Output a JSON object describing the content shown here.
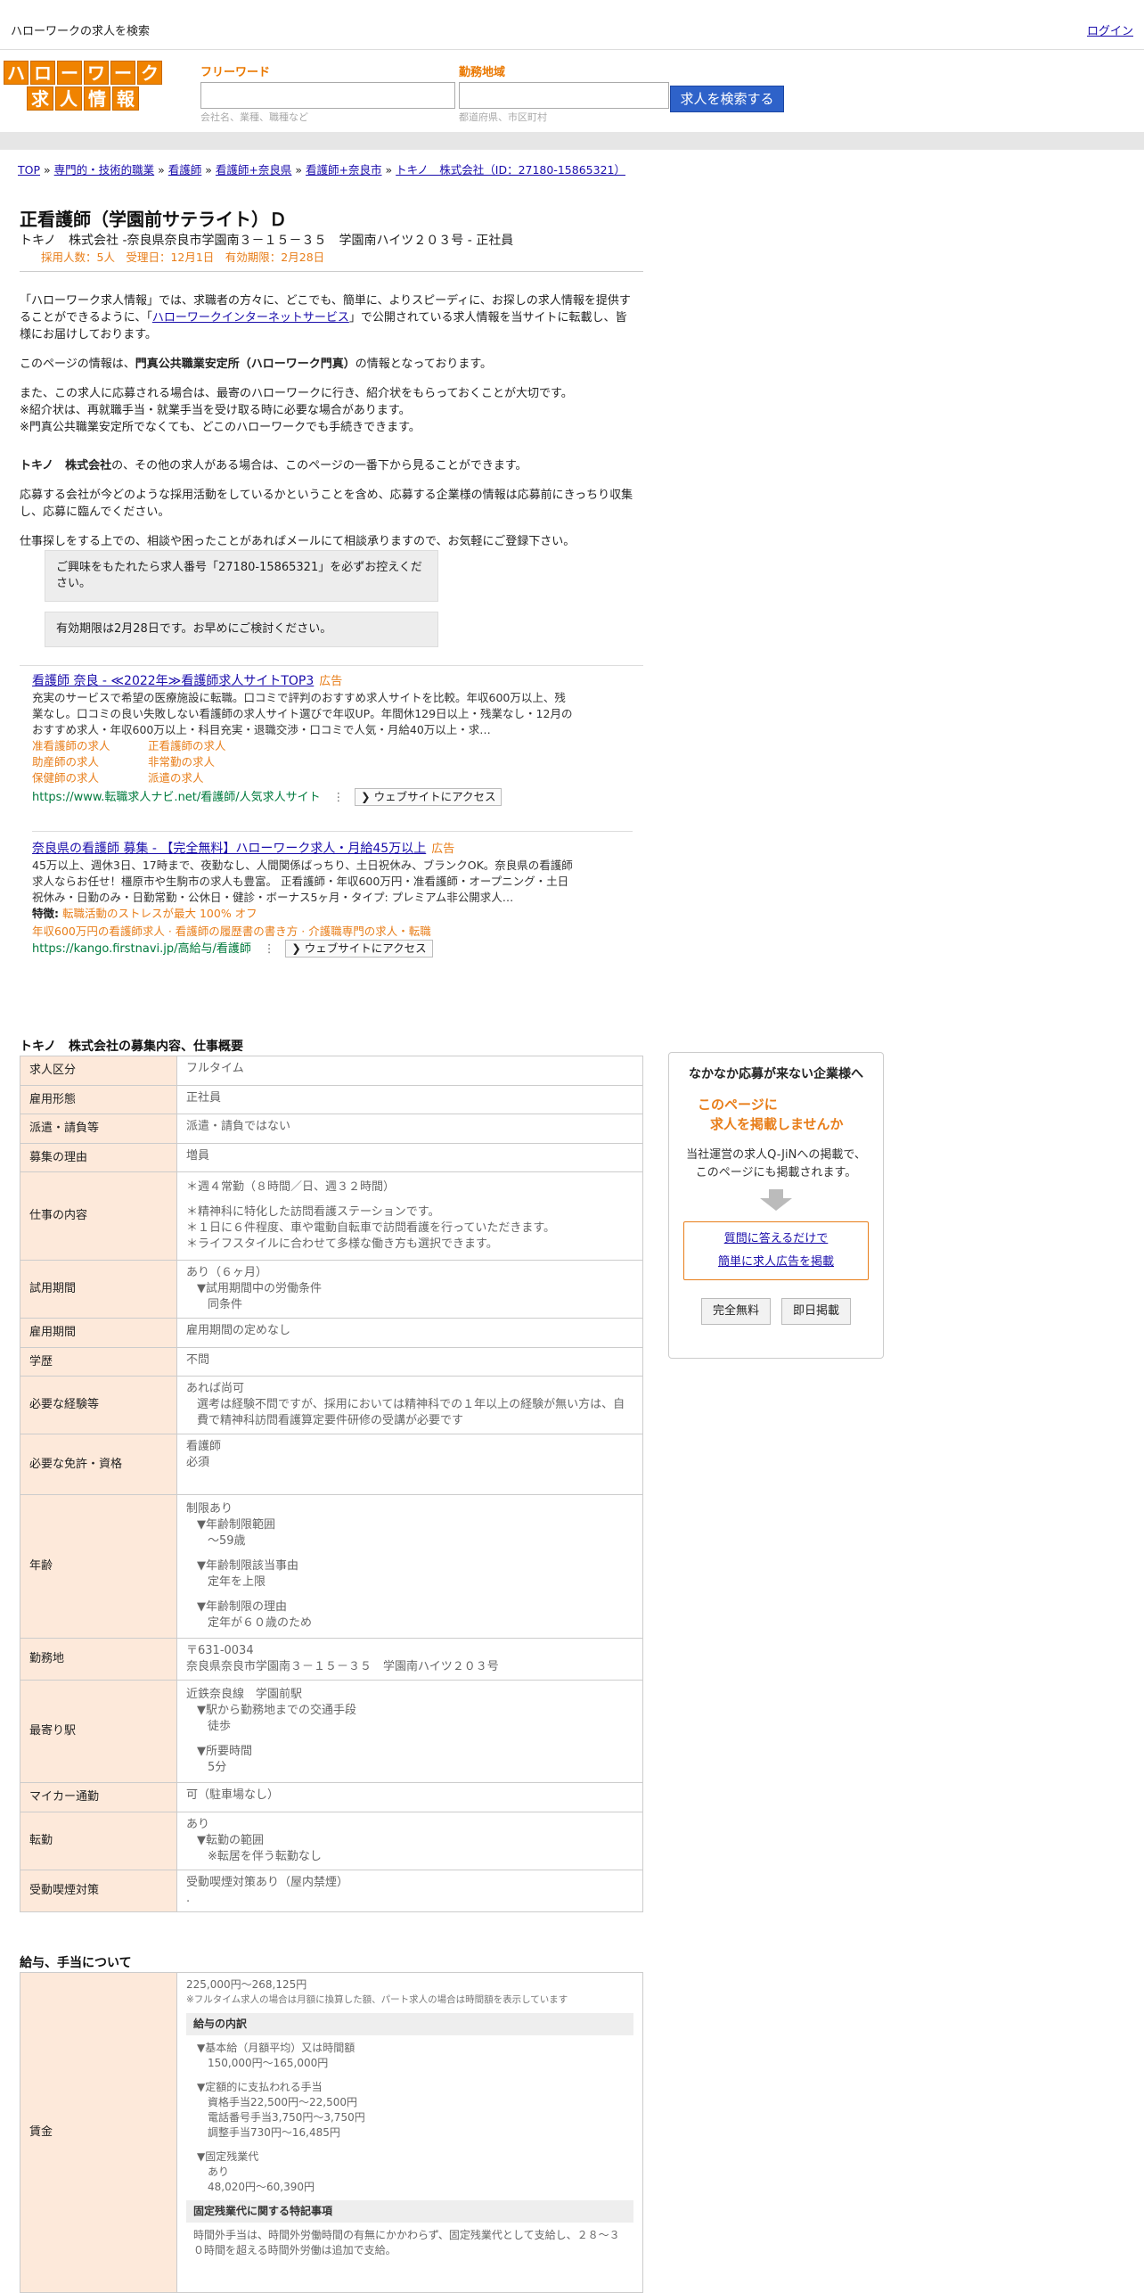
{
  "topbar": {
    "site_title": "ハローワークの求人を検索",
    "login": "ログイン"
  },
  "logo": {
    "row1": [
      "ハ",
      "ロ",
      "ー",
      "ワ",
      "ー",
      "ク"
    ],
    "row2": [
      "求",
      "人",
      "情",
      "報"
    ]
  },
  "search": {
    "keyword_label": "フリーワード",
    "keyword_placeholder": "会社名、業種、職種など",
    "location_label": "勤務地域",
    "location_placeholder": "都道府県、市区町村",
    "button": "求人を検索する"
  },
  "breadcrumb": [
    "TOP",
    "専門的・技術的職業",
    "看護師",
    "看護師+奈良県",
    "看護師+奈良市",
    "トキノ　株式会社（ID：27180-15865321）"
  ],
  "breadcrumb_sep": "»",
  "job": {
    "title": "正看護師（学園前サテライト）Ｄ",
    "company_line": "トキノ　株式会社 -奈良県奈良市学園南３－１５－３５　学園南ハイツ２０３号 - 正社員",
    "meta": "採用人数：5人　受理日：12月1日　有効期限：2月28日"
  },
  "intro": {
    "p1_a": "「ハローワーク求人情報」では、求職者の方々に、どこでも、簡単に、よりスピーディに、お探しの求人情報を提供することができるように、「",
    "p1_link": "ハローワークインターネットサービス",
    "p1_b": "」で公開されている求人情報を当サイトに転載し、皆様にお届けしております。",
    "p2_a": "このページの情報は、",
    "p2_bold": "門真公共職業安定所（ハローワーク門真）",
    "p2_b": "の情報となっております。",
    "p3_1": "また、この求人に応募される場合は、最寄のハローワークに行き、紹介状をもらっておくことが大切です。",
    "p3_2": "※紹介状は、再就職手当・就業手当を受け取る時に必要な場合があります。",
    "p3_3": "※門真公共職業安定所でなくても、どこのハローワークでも手続きできます。",
    "p4_bold": "トキノ　株式会社",
    "p4_rest": "の、その他の求人がある場合は、このページの一番下から見ることができます。",
    "p5": "応募する会社が今どのような採用活動をしているかということを含め、応募する企業様の情報は応募前にきっちり収集し、応募に臨んでください。",
    "p6": "仕事探しをする上での、相談や困ったことがあればメールにて相談承りますので、お気軽にご登録下さい。"
  },
  "notices": [
    "ご興味をもたれたら求人番号「27180-15865321」を必ずお控えください。",
    "有効期限は2月28日です。お早めにご検討ください。"
  ],
  "ads": [
    {
      "title": "看護師 奈良 - ≪2022年≫看護師求人サイトTOP3",
      "tag": "広告",
      "desc": "充実のサービスで希望の医療施設に転職。口コミで評判のおすすめ求人サイトを比較。年収600万以上、残業なし。口コミの良い失敗しない看護師の求人サイト選びで年収UP。年間休129日以上・残業なし・12月のおすすめ求人・年収600万以上・科目充実・退職交渉・口コミで人気・月給40万以上・求…",
      "links": [
        "准看護師の求人",
        "正看護師の求人",
        "助産師の求人",
        "非常勤の求人",
        "保健師の求人",
        "派遣の求人"
      ],
      "url": "https://www.転職求人ナビ.net/看護師/人気求人サイト",
      "visit": "❯ ウェブサイトにアクセス"
    },
    {
      "title": "奈良県の看護師 募集 - 【完全無料】ハローワーク求人・月給45万以上",
      "tag": "広告",
      "desc": "45万以上、週休3日、17時まで、夜勤なし、人間関係ばっちり、土日祝休み、ブランクOK。奈良県の看護師求人ならお任せ！橿原市や生駒市の求人も豊富。 正看護師・年収600万円・准看護師・オープニング・土日祝休み・日勤のみ・日勤常勤・公休日・健診・ボーナス5ヶ月・タイプ: プレミアム非公開求人…",
      "feature_label": "特徴:",
      "feature": "転職活動のストレスが最大 100% オフ",
      "extra": "年収600万円の看護師求人 · 看護師の履歴書の書き方 · 介護職専門の求人・転職",
      "url": "https://kango.firstnavi.jp/高給与/看護師",
      "visit": "❯ ウェブサイトにアクセス"
    }
  ],
  "job_table": {
    "heading": "トキノ　株式会社の募集内容、仕事概要",
    "rows": [
      {
        "label": "求人区分",
        "lines": [
          "フルタイム"
        ]
      },
      {
        "label": "雇用形態",
        "lines": [
          "正社員"
        ]
      },
      {
        "label": "派遣・請負等",
        "lines": [
          "派遣・請負ではない"
        ]
      },
      {
        "label": "募集の理由",
        "lines": [
          "増員"
        ]
      }
    ],
    "work_label": "仕事の内容",
    "work_lines": [
      "＊週４常勤（８時間／日、週３２時間）",
      "",
      "＊精神科に特化した訪問看護ステーションです。",
      "＊１日に６件程度、車や電動自転車で訪問看護を行っていただきます。",
      "＊ライフスタイルに合わせて多様な働き方も選択できます。"
    ],
    "trial_label": "試用期間",
    "trial_lines": [
      "あり（６ヶ月）",
      "▼試用期間中の労働条件",
      "同条件"
    ],
    "period_label": "雇用期間",
    "period_value": "雇用期間の定めなし",
    "edu_label": "学歴",
    "edu_value": "不問",
    "exp_label": "必要な経験等",
    "exp_lines": [
      "あれば尚可",
      "選考は経験不問ですが、採用においては精神科での１年以上の経験が無い方は、自費で精神科訪問看護算定要件研修の受講が必要です"
    ],
    "license_label": "必要な免許・資格",
    "license_lines": [
      "看護師",
      "必須"
    ],
    "age_label": "年齢",
    "age_lines": [
      "制限あり",
      "▼年齢制限範囲",
      "〜59歳",
      "▼年齢制限該当事由",
      "定年を上限",
      "▼年齢制限の理由",
      "定年が６０歳のため"
    ],
    "place_label": "勤務地",
    "place_lines": [
      "〒631-0034",
      "奈良県奈良市学園南３－１５－３５　学園南ハイツ２０３号"
    ],
    "station_label": "最寄り駅",
    "station_lines": [
      "近鉄奈良線　学園前駅",
      "▼駅から勤務地までの交通手段",
      "徒歩",
      "▼所要時間",
      "5分"
    ],
    "car_label": "マイカー通勤",
    "car_value": "可（駐車場なし）",
    "transfer_label": "転勤",
    "transfer_lines": [
      "あり",
      "▼転勤の範囲",
      "※転居を伴う転勤なし"
    ],
    "smoke_label": "受動喫煙対策",
    "smoke_lines": [
      "受動喫煙対策あり（屋内禁煙）",
      "."
    ]
  },
  "wage": {
    "heading": "給与、手当について",
    "label": "賃金",
    "range": "225,000円〜268,125円",
    "note": "※フルタイム求人の場合は月額に換算した額、パート求人の場合は時間額を表示しています",
    "breakdown_h": "給与の内訳",
    "base_h": "▼基本給（月額平均）又は時間額",
    "base_v": "150,000円〜165,000円",
    "fixed_h": "▼定額的に支払われる手当",
    "fixed_1": "資格手当22,500円〜22,500円",
    "fixed_2": "電話番号手当3,750円〜3,750円",
    "fixed_3": "調整手当730円〜16,485円",
    "ot_h": "▼固定残業代",
    "ot_1": "あり",
    "ot_2": "48,020円〜60,390円",
    "ot_note_h": "固定残業代に関する特記事項",
    "ot_note": "時間外手当は、時間外労働時間の有無にかかわらず、固定残業代として支給し、２８～３０時間を超える時間外労働は追加で支給。"
  },
  "side": {
    "head": "なかなか応募が来ない企業様へ",
    "catch1": "このページに",
    "catch2": "求人を掲載しませんか",
    "desc1": "当社運営の求人Q-JiNへの掲載で、",
    "desc2": "このページにも掲載されます。",
    "link1": "質問に答えるだけで",
    "link2": "簡単に求人広告を掲載",
    "btn1": "完全無料",
    "btn2": "即日掲載"
  }
}
